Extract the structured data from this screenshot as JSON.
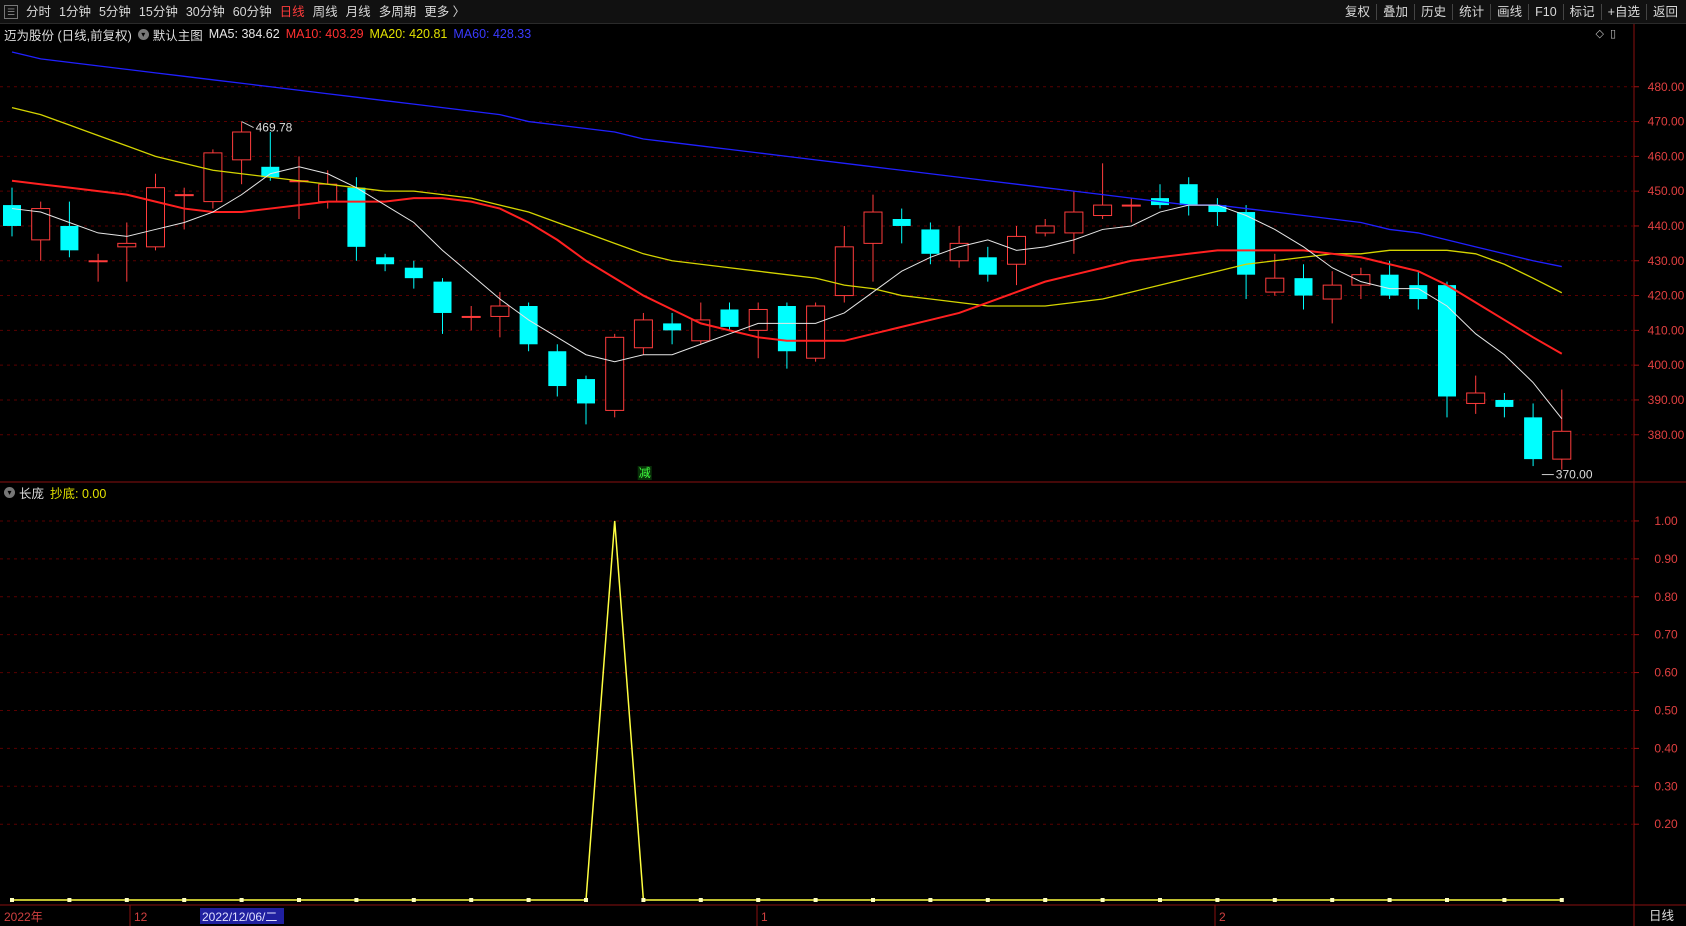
{
  "toolbar": {
    "left_items": [
      "分时",
      "1分钟",
      "5分钟",
      "15分钟",
      "30分钟",
      "60分钟",
      "日线",
      "周线",
      "月线",
      "多周期",
      "更多 〉"
    ],
    "active_index": 6,
    "right_items": [
      "复权",
      "叠加",
      "历史",
      "统计",
      "画线",
      "F10",
      "标记",
      "+自选",
      "返回"
    ]
  },
  "header": {
    "stock_title": "迈为股份 (日线,前复权)",
    "main_chart_label": "默认主图",
    "ma5": "MA5: 384.62",
    "ma10": "MA10: 403.29",
    "ma20": "MA20: 420.81",
    "ma60": "MA60: 428.33"
  },
  "colors": {
    "up": "#ff3c3c",
    "down": "#00ffff",
    "ma5": "#e6e6e6",
    "ma10": "#ff2020",
    "ma20": "#d4d400",
    "ma60": "#2020ff",
    "indicator": "#ffff40",
    "grid": "#5a0000"
  },
  "main_chart": {
    "price_ticks": [
      "480.00",
      "470.00",
      "460.00",
      "450.00",
      "440.00",
      "430.00",
      "420.00",
      "410.00",
      "400.00",
      "390.00",
      "380.00"
    ],
    "high_annotation": "469.78",
    "low_annotation": "370.00",
    "signal_label": "减"
  },
  "indicator_panel": {
    "name": "长庞",
    "value_label": "抄底: 0.00",
    "ticks": [
      "1.00",
      "0.90",
      "0.80",
      "0.70",
      "0.60",
      "0.50",
      "0.40",
      "0.30",
      "0.20"
    ]
  },
  "time_axis": {
    "labels": [
      "2022年",
      "12",
      "2022/12/06/二",
      "1",
      "2"
    ],
    "period_label": "日线"
  },
  "chart_data": {
    "type": "candlestick",
    "price_range": [
      367,
      492
    ],
    "candles": [
      [
        446,
        440,
        451,
        437
      ],
      [
        436,
        445,
        447,
        430
      ],
      [
        440,
        433,
        447,
        431
      ],
      [
        430,
        430,
        432,
        424
      ],
      [
        434,
        435,
        441,
        424
      ],
      [
        434,
        451,
        455,
        433
      ],
      [
        449,
        449,
        451,
        439
      ],
      [
        447,
        461,
        462,
        445
      ],
      [
        459,
        467,
        470,
        452
      ],
      [
        457,
        454,
        467,
        453
      ],
      [
        453,
        453,
        460,
        442
      ],
      [
        447,
        452,
        456,
        445
      ],
      [
        451,
        434,
        454,
        430
      ],
      [
        431,
        429,
        432,
        427
      ],
      [
        428,
        425,
        430,
        422
      ],
      [
        424,
        415,
        425,
        409
      ],
      [
        414,
        414,
        417,
        410
      ],
      [
        414,
        417,
        421,
        408
      ],
      [
        417,
        406,
        418,
        404
      ],
      [
        404,
        394,
        406,
        391
      ],
      [
        396,
        389,
        397,
        383
      ],
      [
        387,
        408,
        409,
        385
      ],
      [
        405,
        413,
        415,
        403
      ],
      [
        412,
        410,
        415,
        406
      ],
      [
        407,
        413,
        418,
        406
      ],
      [
        416,
        411,
        418,
        410
      ],
      [
        410,
        416,
        418,
        402
      ],
      [
        417,
        404,
        418,
        399
      ],
      [
        402,
        417,
        418,
        401
      ],
      [
        420,
        434,
        440,
        418
      ],
      [
        435,
        444,
        449,
        424
      ],
      [
        442,
        440,
        445,
        435
      ],
      [
        439,
        432,
        441,
        429
      ],
      [
        430,
        435,
        440,
        428
      ],
      [
        431,
        426,
        434,
        424
      ],
      [
        429,
        437,
        440,
        423
      ],
      [
        438,
        440,
        442,
        437
      ],
      [
        438,
        444,
        450,
        432
      ],
      [
        443,
        446,
        458,
        442
      ],
      [
        446,
        446,
        448,
        441
      ],
      [
        448,
        446,
        452,
        445
      ],
      [
        452,
        446,
        454,
        443
      ],
      [
        446,
        444,
        448,
        440
      ],
      [
        444,
        426,
        446,
        419
      ],
      [
        421,
        425,
        432,
        420
      ],
      [
        425,
        420,
        429,
        416
      ],
      [
        419,
        423,
        427,
        412
      ],
      [
        423,
        426,
        428,
        419
      ],
      [
        426,
        420,
        430,
        419
      ],
      [
        423,
        419,
        427,
        416
      ],
      [
        423,
        391,
        424,
        385
      ],
      [
        389,
        392,
        397,
        386
      ],
      [
        390,
        388,
        392,
        385
      ],
      [
        385,
        373,
        389,
        371
      ],
      [
        373,
        381,
        393,
        370
      ]
    ],
    "ma5": [
      445,
      444,
      441,
      438,
      437,
      439,
      441,
      444,
      449,
      455,
      457,
      455,
      451,
      446,
      441,
      433,
      426,
      419,
      413,
      408,
      403,
      401,
      403,
      403,
      406,
      409,
      412,
      412,
      412,
      415,
      421,
      427,
      431,
      434,
      436,
      433,
      434,
      436,
      439,
      440,
      444,
      446,
      446,
      443,
      439,
      434,
      428,
      424,
      422,
      422,
      417,
      409,
      403,
      395,
      384.62
    ],
    "ma10": [
      453,
      452,
      451,
      450,
      449,
      447,
      445,
      444,
      444,
      445,
      446,
      447,
      447,
      447,
      448,
      448,
      447,
      445,
      441,
      436,
      430,
      425,
      420,
      416,
      412,
      410,
      408,
      407,
      407,
      407,
      409,
      411,
      413,
      415,
      418,
      421,
      424,
      426,
      428,
      430,
      431,
      432,
      433,
      433,
      433,
      433,
      432,
      431,
      429,
      427,
      423,
      418,
      413,
      408,
      403.29
    ],
    "ma20": [
      474,
      472,
      469,
      466,
      463,
      460,
      458,
      456,
      455,
      454,
      453,
      452,
      451,
      450,
      450,
      449,
      448,
      446,
      444,
      441,
      438,
      435,
      432,
      430,
      429,
      428,
      427,
      426,
      425,
      423,
      422,
      420,
      419,
      418,
      417,
      417,
      417,
      418,
      419,
      421,
      423,
      425,
      427,
      429,
      430,
      431,
      432,
      432,
      433,
      433,
      433,
      432,
      429,
      425,
      420.81
    ],
    "ma60": [
      490,
      488,
      487,
      486,
      485,
      484,
      483,
      482,
      481,
      480,
      479,
      478,
      477,
      476,
      475,
      474,
      473,
      472,
      470,
      469,
      468,
      467,
      465,
      464,
      463,
      462,
      461,
      460,
      459,
      458,
      457,
      456,
      455,
      454,
      453,
      452,
      451,
      450,
      449,
      448,
      447,
      446,
      446,
      445,
      444,
      443,
      442,
      441,
      439,
      438,
      436,
      434,
      432,
      430,
      428.33
    ],
    "indicator_values": [
      0,
      0,
      0,
      0,
      0,
      0,
      0,
      0,
      0,
      0,
      0,
      0,
      0,
      0,
      0,
      0,
      0,
      0,
      0,
      0,
      0,
      1,
      0,
      0,
      0,
      0,
      0,
      0,
      0,
      0,
      0,
      0,
      0,
      0,
      0,
      0,
      0,
      0,
      0,
      0,
      0,
      0,
      0,
      0,
      0,
      0,
      0,
      0,
      0,
      0,
      0,
      0,
      0,
      0,
      0
    ],
    "indicator_range": [
      0,
      1.05
    ]
  }
}
